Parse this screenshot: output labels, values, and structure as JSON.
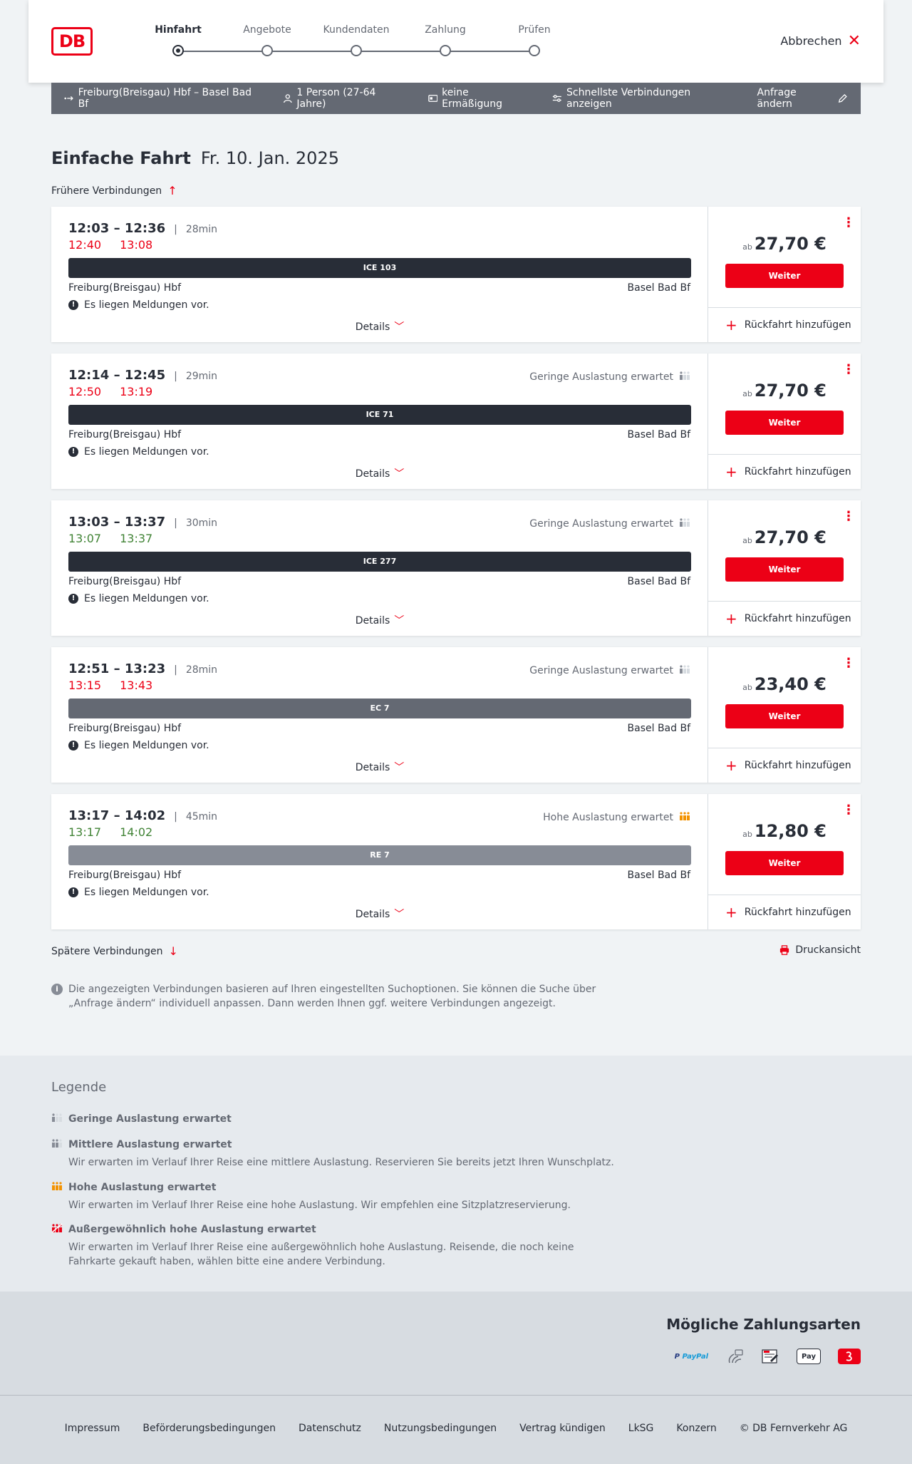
{
  "header": {
    "logo": "DB",
    "steps": [
      "Hinfahrt",
      "Angebote",
      "Kundendaten",
      "Zahlung",
      "Prüfen"
    ],
    "cancel": "Abbrechen"
  },
  "searchbar": {
    "route": "Freiburg(Breisgau) Hbf – Basel Bad Bf",
    "persons": "1 Person (27-64 Jahre)",
    "discount": "keine Ermäßigung",
    "filter": "Schnellste Verbindungen anzeigen",
    "edit": "Anfrage ändern"
  },
  "page": {
    "title": "Einfache Fahrt",
    "date": "Fr. 10. Jan. 2025",
    "earlier": "Frühere Verbindungen",
    "later": "Spätere Verbindungen",
    "print": "Druckansicht",
    "info": "Die angezeigten Verbindungen basieren auf Ihren eingestellten Suchoptionen. Sie können die Suche über „Anfrage ändern“ individuell anpassen. Dann werden Ihnen ggf. weitere Verbindungen angezeigt."
  },
  "card_labels": {
    "from": "Freiburg(Breisgau) Hbf",
    "to": "Basel Bad Bf",
    "message": "Es liegen Meldungen vor.",
    "details": "Details",
    "ab": "ab",
    "weiter": "Weiter",
    "return": "Rückfahrt hinzufügen"
  },
  "connections": [
    {
      "times": "12:03 – 12:36",
      "duration": "28min",
      "rt_dep": "12:40",
      "rt_arr": "13:08",
      "rt_status": "delayed",
      "load": "",
      "load_level": "none",
      "train": "ICE 103",
      "train_color": "#282d37",
      "price": "27,70 €"
    },
    {
      "times": "12:14 – 12:45",
      "duration": "29min",
      "rt_dep": "12:50",
      "rt_arr": "13:19",
      "rt_status": "delayed",
      "load": "Geringe Auslastung erwartet",
      "load_level": "low",
      "train": "ICE 71",
      "train_color": "#282d37",
      "price": "27,70 €"
    },
    {
      "times": "13:03 – 13:37",
      "duration": "30min",
      "rt_dep": "13:07",
      "rt_arr": "13:37",
      "rt_status": "ontime",
      "load": "Geringe Auslastung erwartet",
      "load_level": "low",
      "train": "ICE 277",
      "train_color": "#282d37",
      "price": "27,70 €"
    },
    {
      "times": "12:51 – 13:23",
      "duration": "28min",
      "rt_dep": "13:15",
      "rt_arr": "13:43",
      "rt_status": "delayed",
      "load": "Geringe Auslastung erwartet",
      "load_level": "low",
      "train": "EC 7",
      "train_color": "#646973",
      "price": "23,40 €"
    },
    {
      "times": "13:17 – 14:02",
      "duration": "45min",
      "rt_dep": "13:17",
      "rt_arr": "14:02",
      "rt_status": "ontime",
      "load": "Hohe Auslastung erwartet",
      "load_level": "high",
      "train": "RE 7",
      "train_color": "#878c96",
      "price": "12,80 €"
    }
  ],
  "legend": {
    "title": "Legende",
    "items": [
      {
        "title": "Geringe Auslastung erwartet",
        "desc": "",
        "level": "low"
      },
      {
        "title": "Mittlere Auslastung erwartet",
        "desc": "Wir erwarten im Verlauf Ihrer Reise eine mittlere Auslastung. Reservieren Sie bereits jetzt Ihren Wunschplatz.",
        "level": "medium"
      },
      {
        "title": "Hohe Auslastung erwartet",
        "desc": "Wir erwarten im Verlauf Ihrer Reise eine hohe Auslastung. Wir empfehlen eine Sitzplatzreservierung.",
        "level": "high"
      },
      {
        "title": "Außergewöhnlich hohe Auslastung erwartet",
        "desc": "Wir erwarten im Verlauf Ihrer Reise eine außergewöhnlich hohe Auslastung. Reisende, die noch keine Fahrkarte gekauft haben, wählen bitte eine andere Verbindung.",
        "level": "extreme"
      }
    ]
  },
  "payment": {
    "title": "Mögliche Zahlungsarten",
    "methods": [
      "PayPal",
      "credit-card-icon",
      "sepa-icon",
      "Pay",
      "db-bonus-icon"
    ]
  },
  "footer": {
    "links": [
      "Impressum",
      "Beförderungsbedingungen",
      "Datenschutz",
      "Nutzungsbedingungen",
      "Vertrag kündigen",
      "LkSG",
      "Konzern",
      "© DB Fernverkehr AG"
    ]
  },
  "colors": {
    "accent": "#ec0016",
    "delay": "#ec0016",
    "ontime": "#408335",
    "high_load": "#f39200"
  }
}
